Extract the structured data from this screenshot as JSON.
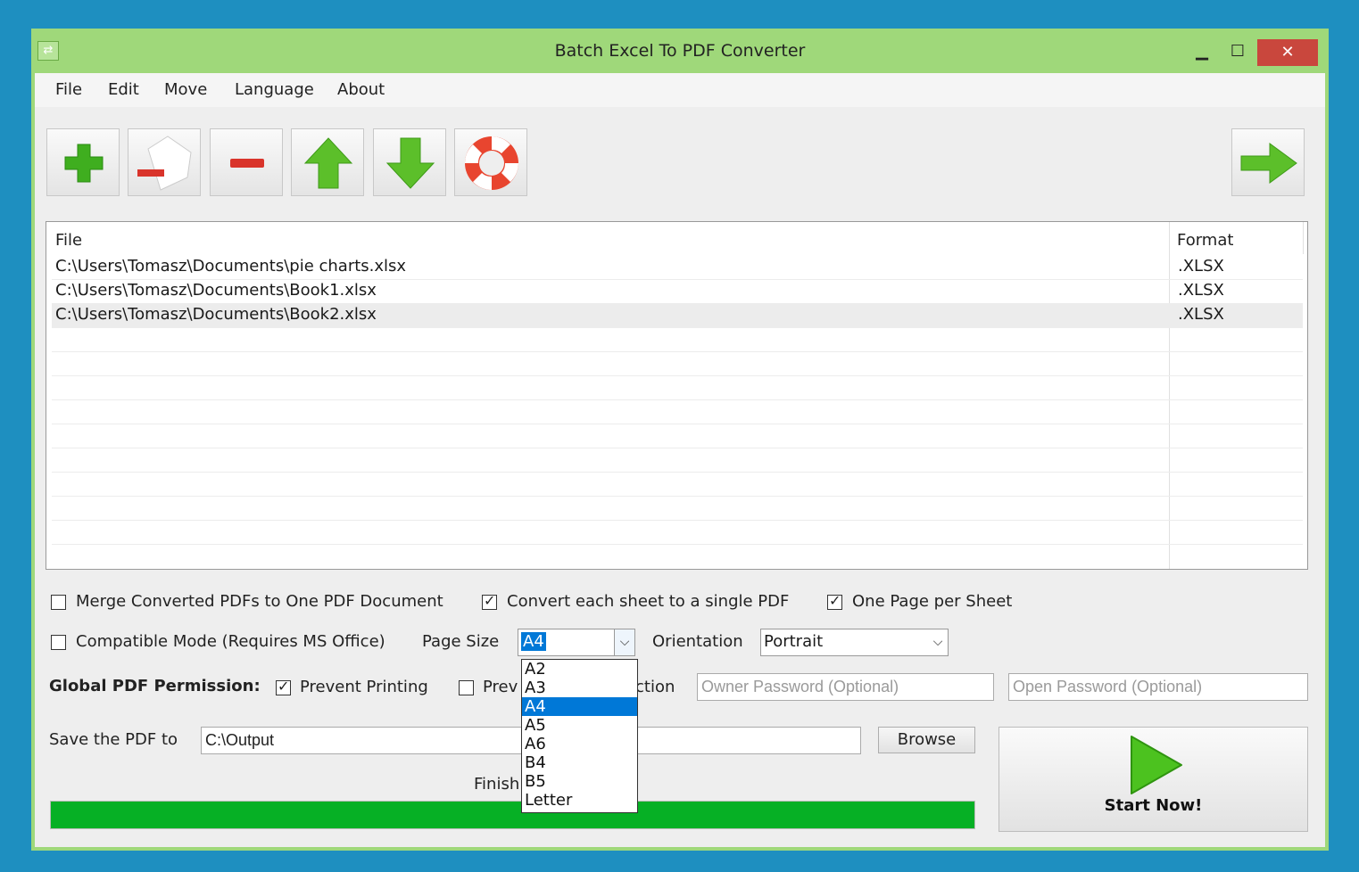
{
  "window": {
    "title": "Batch Excel To PDF Converter"
  },
  "menu": [
    "File",
    "Edit",
    "Move",
    "Language",
    "About"
  ],
  "toolbar": {
    "add": "plus-icon",
    "remove_file": "remove-document-icon",
    "remove": "minus-icon",
    "move_up": "arrow-up-icon",
    "move_down": "arrow-down-icon",
    "help": "lifebuoy-icon",
    "next": "arrow-right-icon"
  },
  "file_list": {
    "columns": [
      "File",
      "Format"
    ],
    "rows": [
      {
        "file": "C:\\Users\\Tomasz\\Documents\\pie charts.xlsx",
        "format": ".XLSX"
      },
      {
        "file": "C:\\Users\\Tomasz\\Documents\\Book1.xlsx",
        "format": ".XLSX"
      },
      {
        "file": "C:\\Users\\Tomasz\\Documents\\Book2.xlsx",
        "format": ".XLSX"
      }
    ]
  },
  "options": {
    "merge_label": "Merge Converted PDFs to One PDF Document",
    "merge_checked": false,
    "sheet_single_label": "Convert each sheet to a single PDF",
    "sheet_single_checked": true,
    "one_page_label": "One Page per Sheet",
    "one_page_checked": true,
    "compatible_label": "Compatible Mode (Requires MS Office)",
    "compatible_checked": false,
    "page_size_label": "Page Size",
    "page_size_value": "A4",
    "page_size_options": [
      "A2",
      "A3",
      "A4",
      "A5",
      "A6",
      "B4",
      "B5",
      "Letter"
    ],
    "orientation_label": "Orientation",
    "orientation_value": "Portrait"
  },
  "permissions": {
    "label": "Global PDF Permission:",
    "prevent_printing_label": "Prevent Printing",
    "prevent_printing_checked": true,
    "second_label_left": "Prev",
    "second_label_right": "ction",
    "second_checked": false,
    "owner_password_placeholder": "Owner Password (Optional)",
    "open_password_placeholder": "Open Password (Optional)"
  },
  "output": {
    "label": "Save the PDF to",
    "path": "C:\\Output",
    "browse_label": "Browse"
  },
  "status": {
    "text_visible": "Finish",
    "progress_percent": 100,
    "progress_color": "#06b025"
  },
  "start": {
    "label": "Start Now!"
  }
}
